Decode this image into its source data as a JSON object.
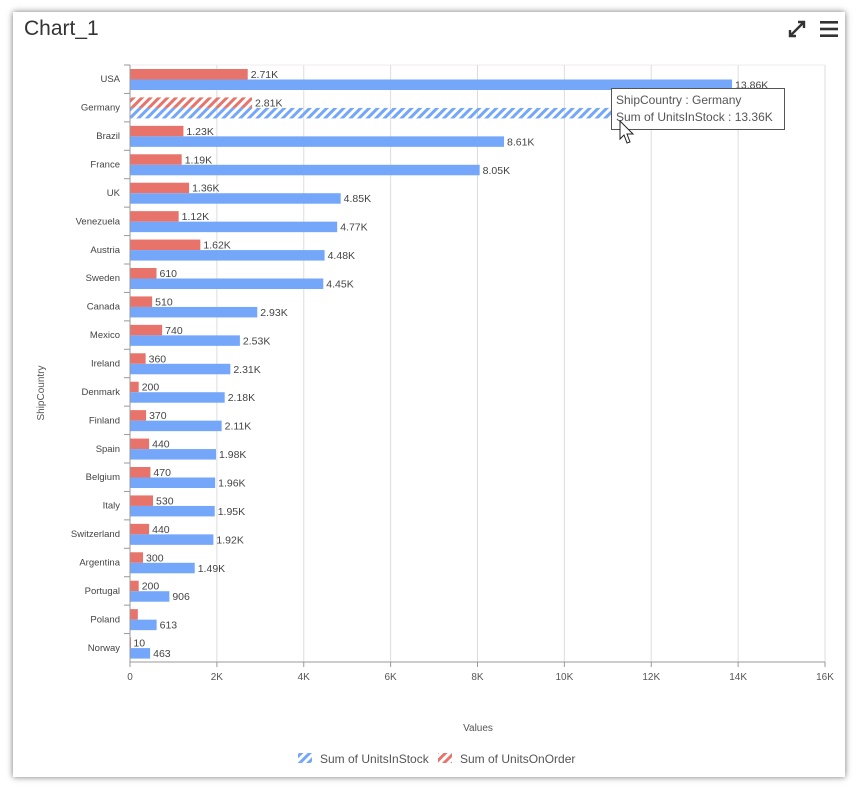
{
  "header": {
    "title": "Chart_1",
    "icons": [
      "expand-icon",
      "menu-icon"
    ]
  },
  "tooltip": {
    "line1": "ShipCountry : Germany",
    "line2": "Sum of UnitsInStock : 13.36K"
  },
  "chart_data": {
    "type": "bar",
    "orientation": "horizontal",
    "xlabel": "Values",
    "ylabel": "ShipCountry",
    "xlim": [
      0,
      16000
    ],
    "xticks": [
      "0",
      "2K",
      "4K",
      "6K",
      "8K",
      "10K",
      "12K",
      "14K",
      "16K"
    ],
    "grid": true,
    "legend": "bottom",
    "categories": [
      "USA",
      "Germany",
      "Brazil",
      "France",
      "UK",
      "Venezuela",
      "Austria",
      "Sweden",
      "Canada",
      "Mexico",
      "Ireland",
      "Denmark",
      "Finland",
      "Spain",
      "Belgium",
      "Italy",
      "Switzerland",
      "Argentina",
      "Portugal",
      "Poland",
      "Norway"
    ],
    "series": [
      {
        "name": "Sum of UnitsOnOrder",
        "color": "#e8736a",
        "values": [
          2710,
          2810,
          1230,
          1190,
          1360,
          1120,
          1620,
          610,
          510,
          740,
          360,
          200,
          370,
          440,
          470,
          530,
          440,
          300,
          200,
          180,
          10
        ],
        "labels": [
          "2.71K",
          "2.81K",
          "1.23K",
          "1.19K",
          "1.36K",
          "1.12K",
          "1.62K",
          "610",
          "510",
          "740",
          "360",
          "200",
          "370",
          "440",
          "470",
          "530",
          "440",
          "300",
          "200",
          "",
          "10"
        ]
      },
      {
        "name": "Sum of UnitsInStock",
        "color": "#74a7fa",
        "values": [
          13860,
          13360,
          8610,
          8050,
          4850,
          4770,
          4480,
          4450,
          2930,
          2530,
          2310,
          2180,
          2110,
          1980,
          1960,
          1950,
          1920,
          1490,
          906,
          613,
          463
        ],
        "labels": [
          "13.86K",
          "13.36K",
          "8.61K",
          "8.05K",
          "4.85K",
          "4.77K",
          "4.48K",
          "4.45K",
          "2.93K",
          "2.53K",
          "2.31K",
          "2.18K",
          "2.11K",
          "1.98K",
          "1.96K",
          "1.95K",
          "1.92K",
          "1.49K",
          "906",
          "613",
          "463"
        ]
      }
    ],
    "highlighted_category": "Germany"
  }
}
